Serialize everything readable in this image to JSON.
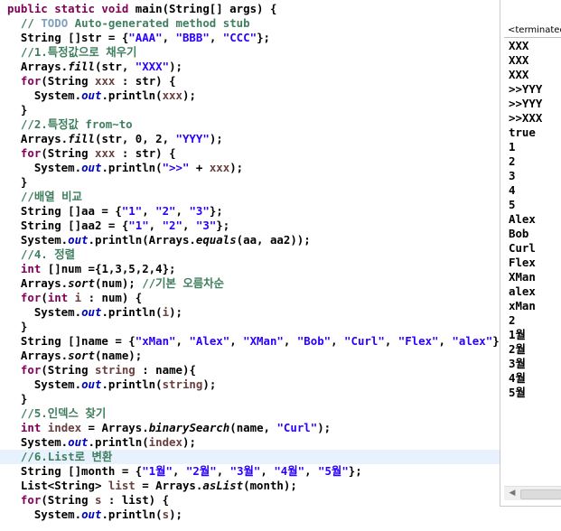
{
  "editor": {
    "lines": [
      [
        [
          "kw",
          "public static void "
        ],
        [
          "pl",
          "main(String[] args) {"
        ]
      ],
      [
        [
          "pl",
          "  "
        ],
        [
          "cm",
          "// "
        ],
        [
          "todo",
          "TODO"
        ],
        [
          "cm",
          " Auto-generated method stub"
        ]
      ],
      [
        [
          "pl",
          "  String []str = {"
        ],
        [
          "str",
          "\"AAA\""
        ],
        [
          "pl",
          ", "
        ],
        [
          "str",
          "\"BBB\""
        ],
        [
          "pl",
          ", "
        ],
        [
          "str",
          "\"CCC\""
        ],
        [
          "pl",
          "};"
        ]
      ],
      [
        [
          "pl",
          "  "
        ],
        [
          "cm",
          "//1.특정값으로 채우기"
        ]
      ],
      [
        [
          "pl",
          "  Arrays."
        ],
        [
          "it",
          "fill"
        ],
        [
          "pl",
          "(str, "
        ],
        [
          "str",
          "\"XXX\""
        ],
        [
          "pl",
          ");"
        ]
      ],
      [
        [
          "pl",
          "  "
        ],
        [
          "kw",
          "for"
        ],
        [
          "pl",
          "(String "
        ],
        [
          "var",
          "xxx"
        ],
        [
          "pl",
          " : str) {"
        ]
      ],
      [
        [
          "pl",
          "    System."
        ],
        [
          "fld",
          "out"
        ],
        [
          "pl",
          ".println("
        ],
        [
          "var",
          "xxx"
        ],
        [
          "pl",
          ");"
        ]
      ],
      [
        [
          "pl",
          "  }"
        ]
      ],
      [
        [
          "pl",
          "  "
        ],
        [
          "cm",
          "//2.특정값 from~to"
        ]
      ],
      [
        [
          "pl",
          "  Arrays."
        ],
        [
          "it",
          "fill"
        ],
        [
          "pl",
          "(str, 0, 2, "
        ],
        [
          "str",
          "\"YYY\""
        ],
        [
          "pl",
          ");"
        ]
      ],
      [
        [
          "pl",
          "  "
        ],
        [
          "kw",
          "for"
        ],
        [
          "pl",
          "(String "
        ],
        [
          "var",
          "xxx"
        ],
        [
          "pl",
          " : str) {"
        ]
      ],
      [
        [
          "pl",
          "    System."
        ],
        [
          "fld",
          "out"
        ],
        [
          "pl",
          ".println("
        ],
        [
          "str",
          "\">>\""
        ],
        [
          "pl",
          " + "
        ],
        [
          "var",
          "xxx"
        ],
        [
          "pl",
          ");"
        ]
      ],
      [
        [
          "pl",
          "  }"
        ]
      ],
      [
        [
          "pl",
          "  "
        ],
        [
          "cm",
          "//배열 비교"
        ]
      ],
      [
        [
          "pl",
          "  String []aa = {"
        ],
        [
          "str",
          "\"1\""
        ],
        [
          "pl",
          ", "
        ],
        [
          "str",
          "\"2\""
        ],
        [
          "pl",
          ", "
        ],
        [
          "str",
          "\"3\""
        ],
        [
          "pl",
          "};"
        ]
      ],
      [
        [
          "pl",
          "  String []aa2 = {"
        ],
        [
          "str",
          "\"1\""
        ],
        [
          "pl",
          ", "
        ],
        [
          "str",
          "\"2\""
        ],
        [
          "pl",
          ", "
        ],
        [
          "str",
          "\"3\""
        ],
        [
          "pl",
          "};"
        ]
      ],
      [
        [
          "pl",
          "  System."
        ],
        [
          "fld",
          "out"
        ],
        [
          "pl",
          ".println(Arrays."
        ],
        [
          "it",
          "equals"
        ],
        [
          "pl",
          "(aa, aa2));"
        ]
      ],
      [
        [
          "pl",
          "  "
        ],
        [
          "cm",
          "//4. 정렬"
        ]
      ],
      [
        [
          "pl",
          "  "
        ],
        [
          "kw",
          "int"
        ],
        [
          "pl",
          " []num ={1,3,5,2,4};"
        ]
      ],
      [
        [
          "pl",
          "  Arrays."
        ],
        [
          "it",
          "sort"
        ],
        [
          "pl",
          "(num); "
        ],
        [
          "cm",
          "//기본 오름차순"
        ]
      ],
      [
        [
          "pl",
          "  "
        ],
        [
          "kw",
          "for"
        ],
        [
          "pl",
          "("
        ],
        [
          "kw",
          "int"
        ],
        [
          "pl",
          " "
        ],
        [
          "var",
          "i"
        ],
        [
          "pl",
          " : num) {"
        ]
      ],
      [
        [
          "pl",
          "    System."
        ],
        [
          "fld",
          "out"
        ],
        [
          "pl",
          ".println("
        ],
        [
          "var",
          "i"
        ],
        [
          "pl",
          ");"
        ]
      ],
      [
        [
          "pl",
          "  }"
        ]
      ],
      [
        [
          "pl",
          "  String []name = {"
        ],
        [
          "str",
          "\"xMan\""
        ],
        [
          "pl",
          ", "
        ],
        [
          "str",
          "\"Alex\""
        ],
        [
          "pl",
          ", "
        ],
        [
          "str",
          "\"XMan\""
        ],
        [
          "pl",
          ", "
        ],
        [
          "str",
          "\"Bob\""
        ],
        [
          "pl",
          ", "
        ],
        [
          "str",
          "\"Curl\""
        ],
        [
          "pl",
          ", "
        ],
        [
          "str",
          "\"Flex\""
        ],
        [
          "pl",
          ", "
        ],
        [
          "str",
          "\"alex\""
        ],
        [
          "pl",
          "};"
        ]
      ],
      [
        [
          "pl",
          "  Arrays."
        ],
        [
          "it",
          "sort"
        ],
        [
          "pl",
          "(name);"
        ]
      ],
      [
        [
          "pl",
          "  "
        ],
        [
          "kw",
          "for"
        ],
        [
          "pl",
          "(String "
        ],
        [
          "var",
          "string"
        ],
        [
          "pl",
          " : name){"
        ]
      ],
      [
        [
          "pl",
          "    System."
        ],
        [
          "fld",
          "out"
        ],
        [
          "pl",
          ".println("
        ],
        [
          "var",
          "string"
        ],
        [
          "pl",
          ");"
        ]
      ],
      [
        [
          "pl",
          "  }"
        ]
      ],
      [
        [
          "pl",
          "  "
        ],
        [
          "cm",
          "//5.인덱스 찾기"
        ]
      ],
      [
        [
          "pl",
          "  "
        ],
        [
          "kw",
          "int"
        ],
        [
          "pl",
          " "
        ],
        [
          "var",
          "index"
        ],
        [
          "pl",
          " = Arrays."
        ],
        [
          "it",
          "binarySearch"
        ],
        [
          "pl",
          "(name, "
        ],
        [
          "str",
          "\"Curl\""
        ],
        [
          "pl",
          ");"
        ]
      ],
      [
        [
          "pl",
          "  System."
        ],
        [
          "fld",
          "out"
        ],
        [
          "pl",
          ".println("
        ],
        [
          "var",
          "index"
        ],
        [
          "pl",
          ");"
        ]
      ],
      [
        [
          "pl",
          "  "
        ],
        [
          "cm",
          "//6.List로 변환"
        ]
      ],
      [
        [
          "pl",
          "  String []month = {"
        ],
        [
          "str",
          "\"1월\""
        ],
        [
          "pl",
          ", "
        ],
        [
          "str",
          "\"2월\""
        ],
        [
          "pl",
          ", "
        ],
        [
          "str",
          "\"3월\""
        ],
        [
          "pl",
          ", "
        ],
        [
          "str",
          "\"4월\""
        ],
        [
          "pl",
          ", "
        ],
        [
          "str",
          "\"5월\""
        ],
        [
          "pl",
          "};"
        ]
      ],
      [
        [
          "pl",
          "  List<String> "
        ],
        [
          "var",
          "list"
        ],
        [
          "pl",
          " = Arrays."
        ],
        [
          "it",
          "asList"
        ],
        [
          "pl",
          "(month);"
        ]
      ],
      [
        [
          "pl",
          "  "
        ],
        [
          "kw",
          "for"
        ],
        [
          "pl",
          "(String "
        ],
        [
          "var",
          "s"
        ],
        [
          "pl",
          " : list) {"
        ]
      ],
      [
        [
          "pl",
          "    System."
        ],
        [
          "fld",
          "out"
        ],
        [
          "pl",
          ".println("
        ],
        [
          "var",
          "s"
        ],
        [
          "pl",
          ");"
        ]
      ]
    ],
    "highlighted_line": 31
  },
  "console": {
    "header": "<terminated>",
    "output": [
      "XXX",
      "XXX",
      "XXX",
      ">>YYY",
      ">>YYY",
      ">>XXX",
      "true",
      "1",
      "2",
      "3",
      "4",
      "5",
      "Alex",
      "Bob",
      "Curl",
      "Flex",
      "XMan",
      "alex",
      "xMan",
      "2",
      "1월",
      "2월",
      "3월",
      "4월",
      "5월"
    ],
    "scroll_left_icon": "scroll-left-arrow-icon"
  }
}
